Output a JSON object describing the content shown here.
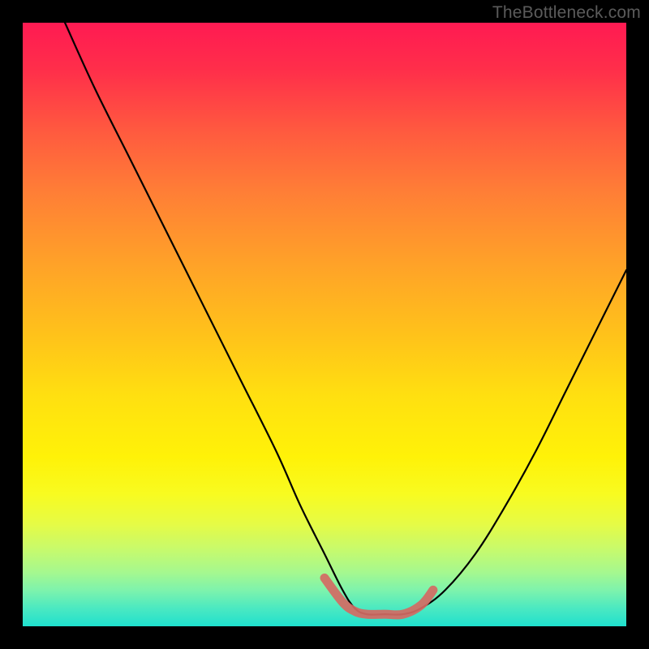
{
  "attribution": "TheBottleneck.com",
  "colors": {
    "frame": "#000000",
    "curve_stroke": "#000000",
    "marker_stroke": "#d46a63",
    "gradient_top": "#ff1a52",
    "gradient_mid": "#ffe010",
    "gradient_bottom": "#1fe0ce"
  },
  "chart_data": {
    "type": "line",
    "title": "",
    "xlabel": "",
    "ylabel": "",
    "xlim": [
      0,
      100
    ],
    "ylim": [
      0,
      100
    ],
    "grid": false,
    "legend": false,
    "series": [
      {
        "name": "bottleneck-curve",
        "x": [
          7,
          12,
          18,
          24,
          30,
          36,
          42,
          46,
          50,
          53,
          55,
          57,
          60,
          63,
          66,
          70,
          75,
          80,
          85,
          90,
          95,
          100
        ],
        "y": [
          100,
          89,
          77,
          65,
          53,
          41,
          29,
          20,
          12,
          6,
          3,
          2,
          2,
          2,
          3,
          6,
          12,
          20,
          29,
          39,
          49,
          59
        ]
      }
    ],
    "markers": {
      "name": "highlight-band",
      "x": [
        50,
        53,
        55,
        57,
        60,
        63,
        66,
        68
      ],
      "y": [
        8,
        4,
        2.5,
        2,
        2,
        2,
        3.5,
        6
      ]
    },
    "annotations": []
  }
}
